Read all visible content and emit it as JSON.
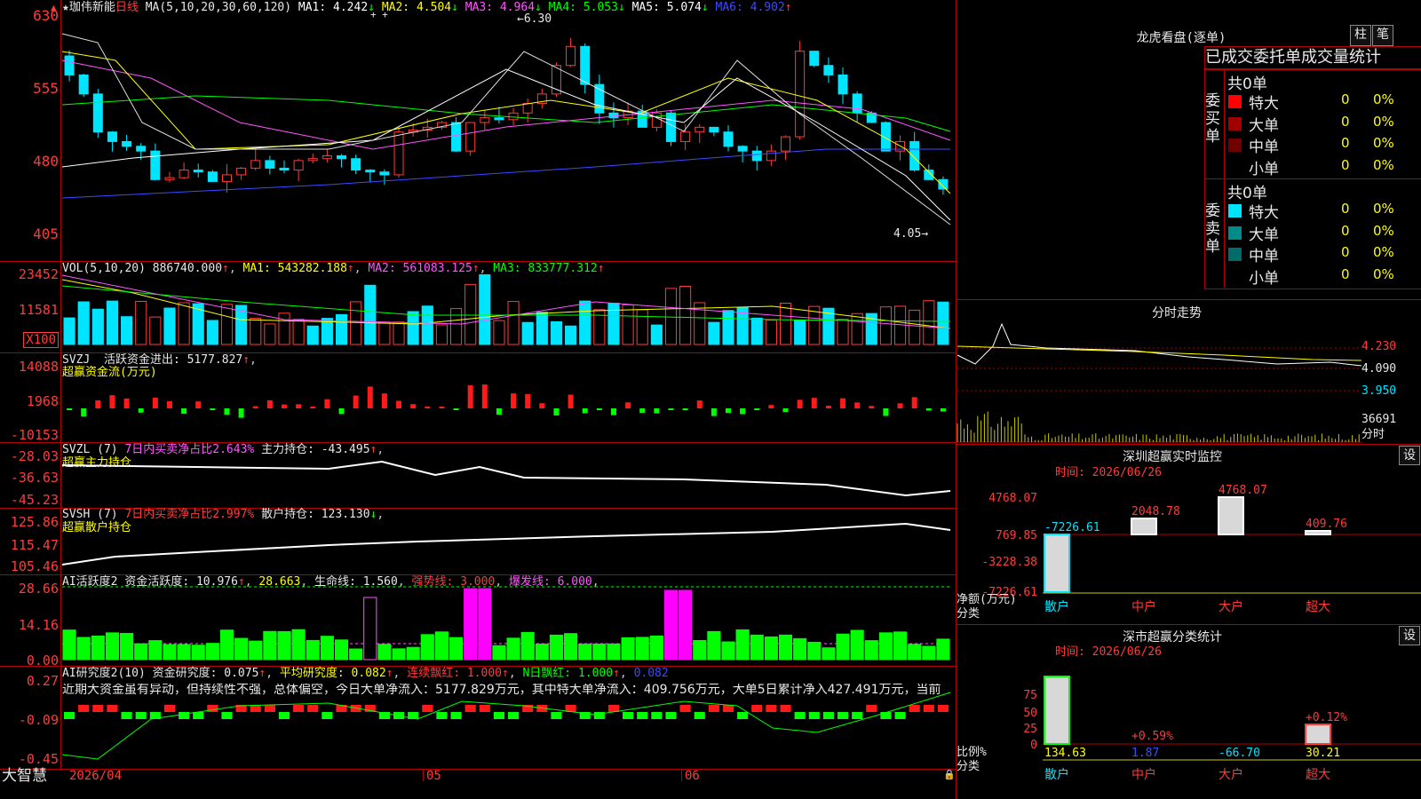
{
  "stock": {
    "name": "珈伟新能",
    "period": "日线",
    "ma_label": "MA(5,10,20,30,60,120)",
    "ma_values": [
      {
        "label": "MA1: 4.242",
        "arrow": "↓",
        "color": "#ffffff"
      },
      {
        "label": "MA2: 4.504",
        "arrow": "↓",
        "color": "#ffff00"
      },
      {
        "label": "MA3: 4.964",
        "arrow": "↓",
        "color": "#ff55ff"
      },
      {
        "label": "MA4: 5.053",
        "arrow": "↓",
        "color": "#00ff00"
      },
      {
        "label": "MA5: 5.074",
        "arrow": "↓",
        "color": "#ffffff"
      },
      {
        "label": "MA6: 4.902",
        "arrow": "↑",
        "color": "#3b4bff"
      }
    ],
    "high_label": "6.30",
    "low_label": "4.05"
  },
  "price_axis": [
    "630",
    "555",
    "480",
    "405"
  ],
  "vol": {
    "label": "VOL(5,10,20)",
    "value": "886740.000",
    "ma1": "MA1: 543282.188",
    "ma2": "MA2: 561083.125",
    "ma3": "MA3: 833777.312",
    "axis": [
      "23452",
      "11581",
      "X100"
    ]
  },
  "svzj": {
    "label": "SVZJ",
    "text1": "活跃资金进出: 5177.827",
    "text2": "超赢资金流(万元)",
    "axis": [
      "14088",
      "1968",
      "-10153"
    ]
  },
  "svzl": {
    "label": "SVZL (7)",
    "text1": "7日内买卖净占比2.643%",
    "text2": "主力持仓: -43.495",
    "text3": "超赢主力持仓",
    "axis": [
      "-28.03",
      "-36.63",
      "-45.23"
    ]
  },
  "svsh": {
    "label": "SVSH (7)",
    "text1": "7日内买卖净占比2.997%",
    "text2": "散户持仓: 123.130",
    "text3": "超赢散户持仓",
    "axis": [
      "125.86",
      "115.47",
      "105.46"
    ]
  },
  "ai1": {
    "label": "AI活跃度2",
    "t1": "资金活跃度: 10.976",
    "t2": "28.663",
    "t3": "生命线: 1.560",
    "t4": "强势线: 3.000",
    "t5": "爆发线: 6.000",
    "axis": [
      "28.66",
      "14.16",
      "0.00"
    ]
  },
  "ai2": {
    "label": "AI研究度2(10)",
    "t1": "资金研究度: 0.075",
    "t2": "平均研究度: 0.082",
    "t3": "连续飘红: 1.000",
    "t4": "N日飘红: 1.000",
    "t5": "0.082",
    "comment": "近期大资金虽有异动，但持续性不强，总体偏空，今日大单净流入：5177.829万元，其中特大单净流入：409.756万元，大单5日累计净入427.491万元，当前",
    "axis": [
      "0.27",
      "-0.09",
      "-0.45"
    ]
  },
  "bottom": {
    "brand": "大智慧",
    "dates": [
      "2026/04",
      "05",
      "06"
    ]
  },
  "right": {
    "lhb_title": "龙虎看盘(逐单)",
    "btn1": "柱",
    "btn2": "笔",
    "tabs": "已成交委托单成交量统计",
    "buy_label": "委买单",
    "sell_label": "委卖单",
    "buy_total": "共0单",
    "sell_total": "共0单",
    "rows": [
      "特大",
      "大单",
      "中单",
      "小单"
    ],
    "zero": "0",
    "pct": "0%",
    "fenshi_title": "分时走势",
    "fenshi_axis": [
      "4.230",
      "4.090",
      "3.950",
      "36691",
      "分时"
    ],
    "sz_title": "深圳超赢实时监控",
    "sz_btn": "设",
    "sz_time": "时间: 2026/06/26",
    "sz_axis": [
      "4768.07",
      "769.85",
      "-3228.38",
      "-7226.61"
    ],
    "sz_vals": [
      "-7226.61",
      "2048.78",
      "4768.07",
      "409.76"
    ],
    "sz_ylab1": "净额(万元)",
    "sz_ylab2": "分类",
    "cats": [
      "散户",
      "中户",
      "大户",
      "超大"
    ],
    "fl_title": "深市超赢分类统计",
    "fl_btn": "设",
    "fl_time": "时间: 2026/06/26",
    "fl_axis": [
      "75",
      "50",
      "25",
      "0"
    ],
    "fl_top": [
      "+0.59%",
      "+0.12%"
    ],
    "fl_vals": [
      "134.63",
      "1.87",
      "-66.70",
      "30.21"
    ],
    "fl_ylab1": "比例%",
    "fl_ylab2": "分类"
  }
}
